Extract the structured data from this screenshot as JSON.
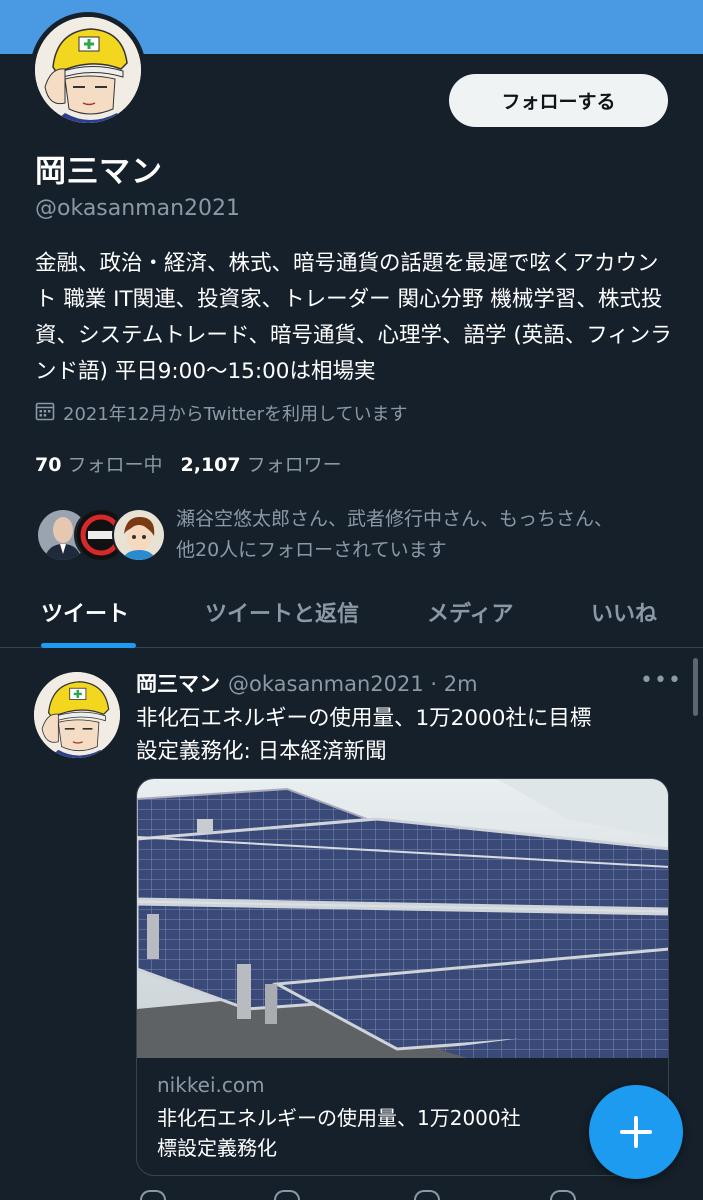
{
  "profile": {
    "name": "岡三マン",
    "handle": "@okasanman2021",
    "follow_label": "フォローする",
    "bio": "金融、政治・経済、株式、暗号通貨の話題を最遅で呟くアカウント 職業 IT関連、投資家、トレーダー 関心分野 機械学習、株式投資、システムトレード、暗号通貨、心理学、語学 (英語、フィンランド語) 平日9:00〜15:00は相場実",
    "joined": "2021年12月からTwitterを利用しています",
    "following_count": "70",
    "following_label": "フォロー中",
    "followers_count": "2,107",
    "followers_label": "フォロワー",
    "followed_by_line1": "瀬谷空悠太郎さん、武者修行中さん、もっちさん、",
    "followed_by_line2": "他20人にフォローされています"
  },
  "tabs": [
    {
      "label": "ツイート",
      "active": true
    },
    {
      "label": "ツイートと返信",
      "active": false
    },
    {
      "label": "メディア",
      "active": false
    },
    {
      "label": "いいね",
      "active": false
    }
  ],
  "tweet": {
    "name": "岡三マン",
    "meta": "@okasanman2021 · 2m",
    "text_line1": "非化石エネルギーの使用量、1万2000社に目標",
    "text_line2": "設定義務化: 日本経済新聞",
    "card_domain": "nikkei.com",
    "card_title_line1": "非化石エネルギーの使用量、1万2000社",
    "card_title_line2": "標設定義務化"
  },
  "icons": {
    "calendar": "calendar-icon",
    "more": "more-icon",
    "compose": "plus-icon"
  },
  "colors": {
    "background": "#15202b",
    "banner": "#4a9ae3",
    "accent": "#1d9bf0",
    "secondary_text": "#8b98a5"
  }
}
